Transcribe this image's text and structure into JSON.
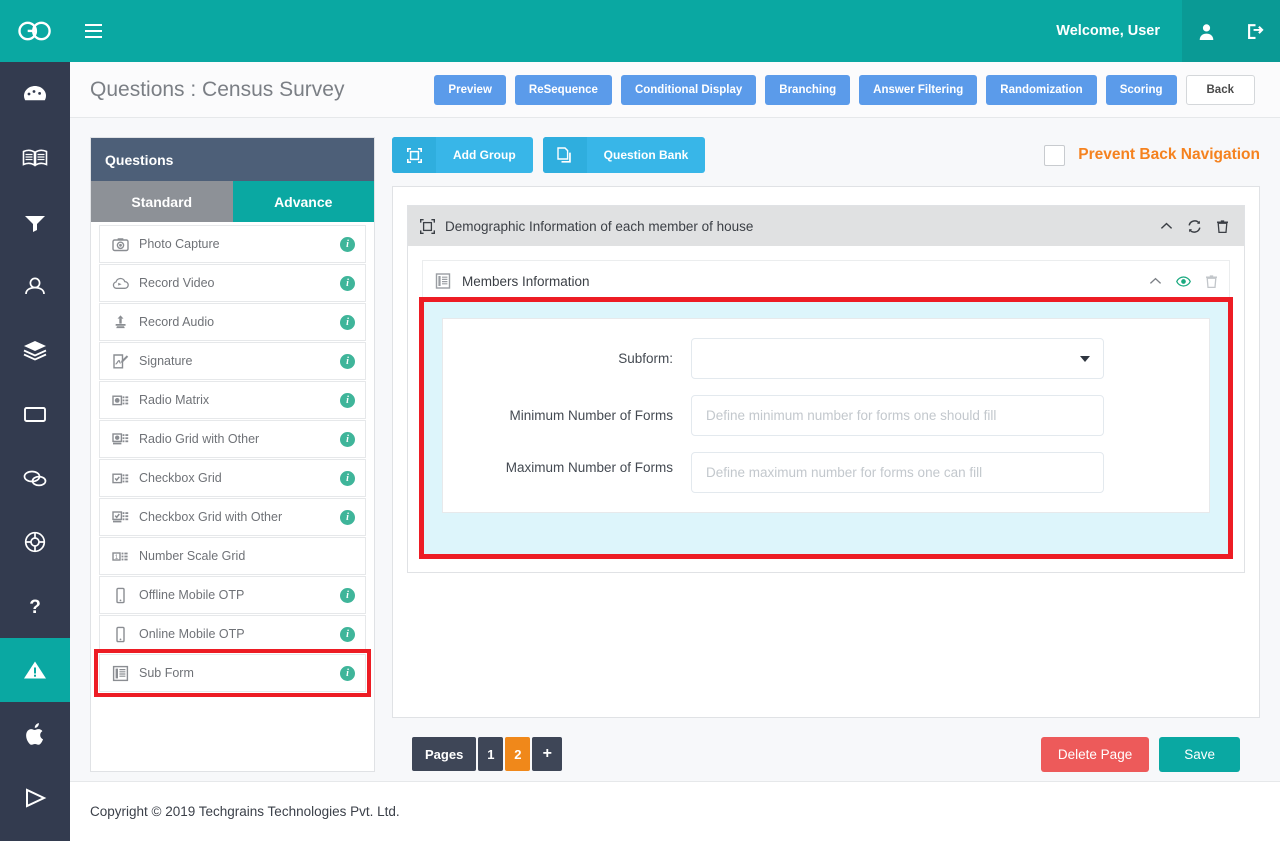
{
  "topbar": {
    "logo_icon": "go-logo-icon",
    "menu_icon": "hamburger-menu-icon",
    "welcome": "Welcome, User",
    "user_icon": "user-icon",
    "logout_icon": "logout-icon"
  },
  "rail": {
    "items": [
      {
        "icon": "dashboard-speedometer-icon",
        "active": false
      },
      {
        "icon": "book-icon",
        "active": false
      },
      {
        "icon": "filter-icon",
        "active": false
      },
      {
        "icon": "user-icon",
        "active": false
      },
      {
        "icon": "layers-icon",
        "active": false
      },
      {
        "icon": "monitor-icon",
        "active": false
      },
      {
        "icon": "chat-bubbles-icon",
        "active": false
      },
      {
        "icon": "lifebuoy-icon",
        "active": false
      },
      {
        "icon": "question-mark-icon",
        "active": false
      },
      {
        "icon": "warning-triangle-icon",
        "active": true
      },
      {
        "icon": "apple-icon",
        "active": false
      },
      {
        "icon": "play-store-icon",
        "active": false
      }
    ]
  },
  "header": {
    "title": "Questions : Census Survey",
    "nav_buttons": [
      "Preview",
      "ReSequence",
      "Conditional Display",
      "Branching",
      "Answer Filtering",
      "Randomization",
      "Scoring"
    ],
    "back_label": "Back"
  },
  "questions_panel": {
    "title": "Questions",
    "tabs": [
      {
        "label": "Standard",
        "active": false
      },
      {
        "label": "Advance",
        "active": true
      }
    ],
    "items": [
      {
        "label": "Photo Capture",
        "icon": "camera-icon",
        "info": true
      },
      {
        "label": "Record Video",
        "icon": "video-cloud-icon",
        "info": true
      },
      {
        "label": "Record Audio",
        "icon": "microphone-upload-icon",
        "info": true
      },
      {
        "label": "Signature",
        "icon": "signature-pad-icon",
        "info": true
      },
      {
        "label": "Radio Matrix",
        "icon": "radio-matrix-icon",
        "info": true
      },
      {
        "label": "Radio Grid with Other",
        "icon": "radio-grid-other-icon",
        "info": true
      },
      {
        "label": "Checkbox Grid",
        "icon": "checkbox-grid-icon",
        "info": true
      },
      {
        "label": "Checkbox Grid with Other",
        "icon": "checkbox-grid-other-icon",
        "info": true
      },
      {
        "label": "Number Scale Grid",
        "icon": "number-scale-grid-icon",
        "info": false
      },
      {
        "label": "Offline Mobile OTP",
        "icon": "mobile-icon",
        "info": true
      },
      {
        "label": "Online Mobile OTP",
        "icon": "mobile-icon",
        "info": true
      },
      {
        "label": "Sub Form",
        "icon": "subform-icon",
        "info": true,
        "highlighted": true
      }
    ]
  },
  "toolbar": {
    "add_group_label": "Add Group",
    "add_group_icon": "group-frame-icon",
    "question_bank_label": "Question Bank",
    "question_bank_icon": "copy-pages-icon",
    "prevent_back_label": "Prevent Back Navigation",
    "prevent_back_checked": false
  },
  "group": {
    "icon": "group-frame-icon",
    "title": "Demographic Information of each member of house",
    "actions": [
      {
        "icon": "chevron-up-icon"
      },
      {
        "icon": "refresh-icon"
      },
      {
        "icon": "trash-icon"
      }
    ],
    "question": {
      "icon": "subform-icon",
      "title": "Members Information",
      "actions": [
        {
          "icon": "chevron-up-icon"
        },
        {
          "icon": "eye-icon"
        },
        {
          "icon": "trash-icon"
        }
      ],
      "form": {
        "subform_label": "Subform:",
        "subform_value": "",
        "min_label": "Minimum Number of Forms",
        "min_placeholder": "Define minimum number for forms one should fill",
        "min_value": "",
        "max_label": "Maximum Number of Forms",
        "max_placeholder": "Define maximum number for forms one can fill",
        "max_value": ""
      }
    }
  },
  "pager": {
    "label": "Pages",
    "pages": [
      {
        "label": "1",
        "active": false
      },
      {
        "label": "2",
        "active": true
      }
    ],
    "add_label": "+"
  },
  "actions": {
    "delete_label": "Delete Page",
    "save_label": "Save"
  },
  "footer": {
    "copyright": "Copyright © 2019 Techgrains Technologies Pvt. Ltd."
  },
  "colors": {
    "teal": "#0aa8a2",
    "rail_dark": "#333b4f",
    "nav_blue": "#5b9bea",
    "tool_blue": "#38b6e8",
    "orange": "#f5821f",
    "page_active": "#f0881a",
    "danger": "#ed5a5a",
    "highlight_red": "#ed1c24",
    "subform_bg": "#ddf5fb"
  }
}
